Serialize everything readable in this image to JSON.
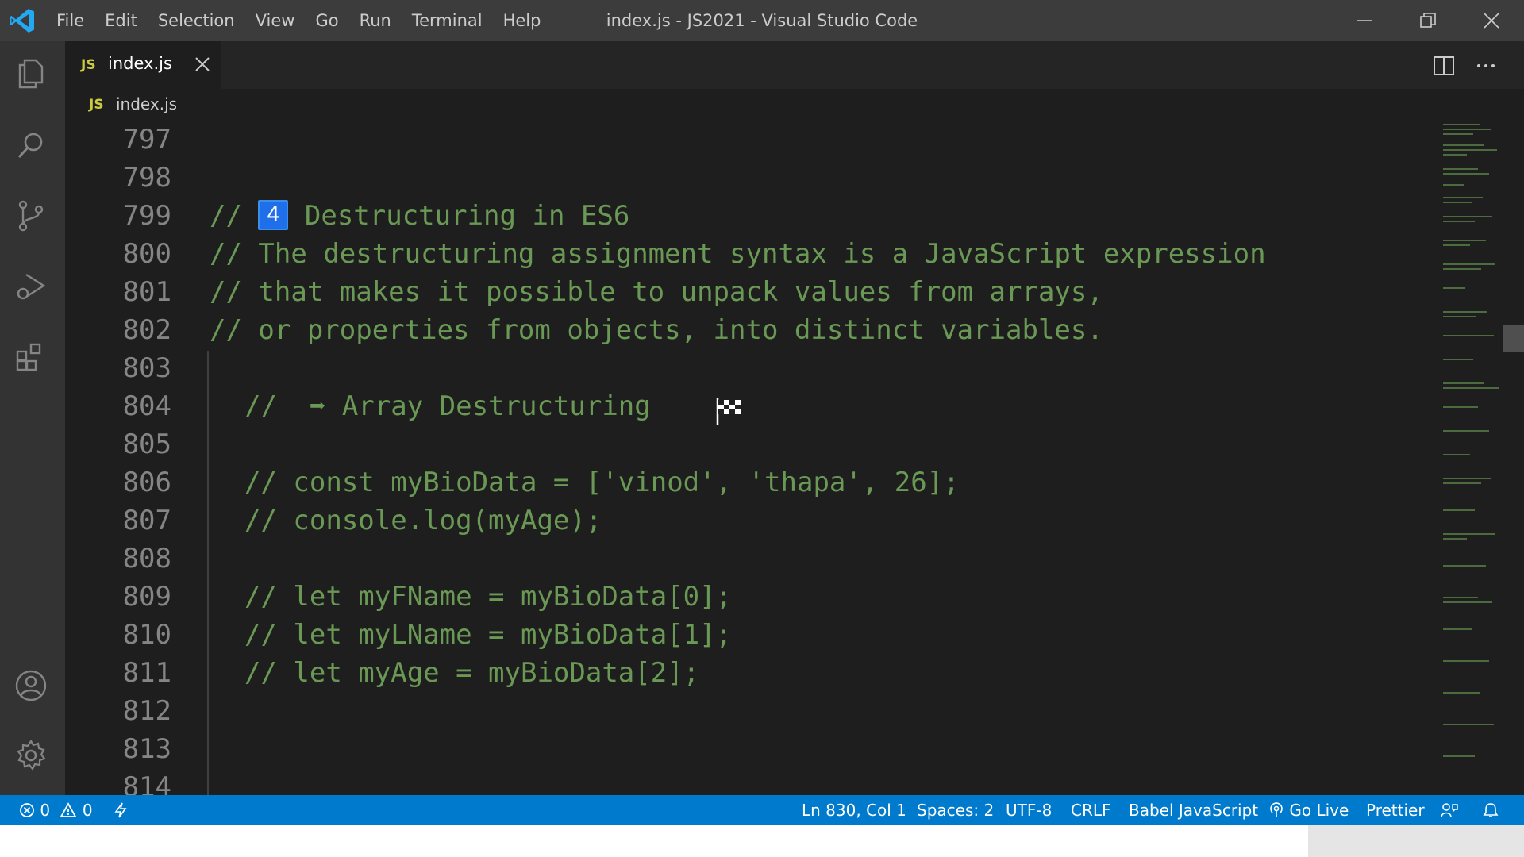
{
  "window": {
    "title": "index.js - JS2021 - Visual Studio Code"
  },
  "menu": [
    "File",
    "Edit",
    "Selection",
    "View",
    "Go",
    "Run",
    "Terminal",
    "Help"
  ],
  "tab": {
    "badge": "JS",
    "label": "index.js"
  },
  "breadcrumb": {
    "badge": "JS",
    "label": "index.js"
  },
  "editor": {
    "lines": [
      {
        "number": "797",
        "text": ""
      },
      {
        "number": "798",
        "text": ""
      },
      {
        "number": "799",
        "prefix": "// ",
        "badge": "4",
        "text": " Destructuring in ES6"
      },
      {
        "number": "800",
        "text": "// The destructuring assignment syntax is a JavaScript expression"
      },
      {
        "number": "801",
        "text": "// that makes it possible to unpack values from arrays,"
      },
      {
        "number": "802",
        "text": "// or properties from objects, into distinct variables."
      },
      {
        "number": "803",
        "text": ""
      },
      {
        "number": "804",
        "text": "//  ➡ Array Destructuring"
      },
      {
        "number": "805",
        "text": ""
      },
      {
        "number": "806",
        "text": "// const myBioData = ['vinod', 'thapa', 26];"
      },
      {
        "number": "807",
        "text": "// console.log(myAge);"
      },
      {
        "number": "808",
        "text": ""
      },
      {
        "number": "809",
        "text": "// let myFName = myBioData[0];"
      },
      {
        "number": "810",
        "text": "// let myLName = myBioData[1];"
      },
      {
        "number": "811",
        "text": "// let myAge = myBioData[2];"
      },
      {
        "number": "812",
        "text": ""
      },
      {
        "number": "813",
        "text": ""
      },
      {
        "number": "814",
        "text": ""
      }
    ]
  },
  "status": {
    "errors": "0",
    "warnings": "0",
    "position": "Ln 830, Col 1",
    "spaces": "Spaces: 2",
    "encoding": "UTF-8",
    "eol": "CRLF",
    "language": "Babel JavaScript",
    "go_live": "Go Live",
    "formatter": "Prettier"
  },
  "colors": {
    "status_bar": "#007acc",
    "comment": "#6a9955",
    "line_number": "#858585",
    "badge": "#1f6feb"
  }
}
